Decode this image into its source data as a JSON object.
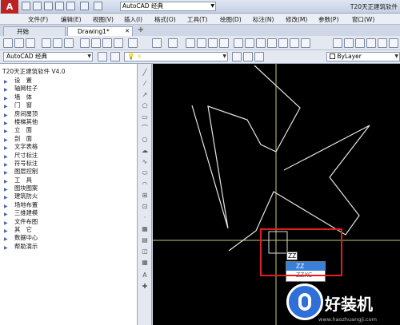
{
  "titlebar": {
    "logo": "A",
    "workspace": "AutoCAD 经典",
    "title": "T20天正建筑软件"
  },
  "menu": [
    "文件(F)",
    "编辑(E)",
    "视图(V)",
    "插入(I)",
    "格式(O)",
    "工具(T)",
    "绘图(D)",
    "标注(N)",
    "修改(M)",
    "参数(P)",
    "窗口(W)"
  ],
  "tabs": {
    "start": "开始",
    "drawing": "Drawing1*"
  },
  "toolbar2": {
    "workspace_combo": "AutoCAD 经典",
    "linetype_combo": "ByLayer"
  },
  "panel": {
    "title": "T20天正建筑软件 V4.0",
    "items": [
      "设　置",
      "轴网柱子",
      "墙　体",
      "门　窗",
      "房间屋顶",
      "楼梯其他",
      "立　面",
      "剖　面",
      "文字表格",
      "尺寸标注",
      "符号标注",
      "图层控制",
      "工　具",
      "图块图案",
      "建筑防火",
      "场地布置",
      "三维建模",
      "文件布图",
      "其　它",
      "数据中心",
      "帮助演示"
    ]
  },
  "command": {
    "input": "ZZ",
    "suggestions": [
      "ZZ",
      "ZZXC"
    ]
  },
  "watermark": {
    "text": "好装机",
    "url": "www.haozhuangji.com"
  },
  "colors": {
    "highlight": "#e02020",
    "canvas": "#000000",
    "crosshair": "#c8c878",
    "accent": "#3a7fd8"
  }
}
